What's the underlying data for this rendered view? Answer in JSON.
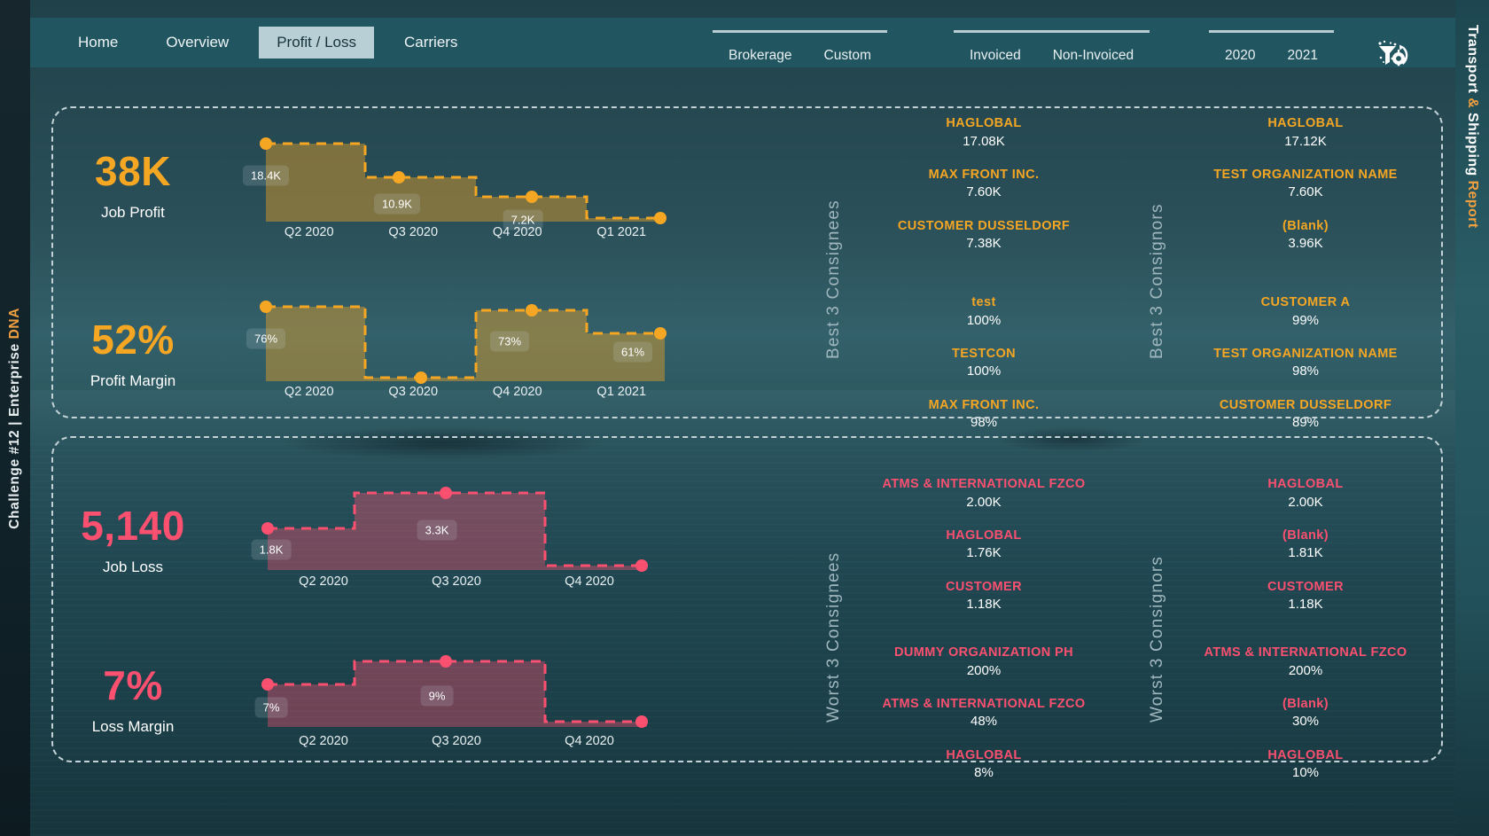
{
  "branding": {
    "left_rail_text": "Challenge #12 | Enterprise DNA",
    "left_rail_plain": "Challenge #12 | Enterprise ",
    "left_rail_accent": "DNA",
    "right_rail_part1": "Transport ",
    "right_rail_accent1": "&",
    "right_rail_part2": " Shipping ",
    "right_rail_accent2": "Report"
  },
  "nav": {
    "tabs": [
      {
        "label": "Home",
        "active": false
      },
      {
        "label": "Overview",
        "active": false
      },
      {
        "label": "Profit / Loss",
        "active": true
      },
      {
        "label": "Carriers",
        "active": false
      }
    ],
    "slicer_type": [
      "Brokerage",
      "Custom"
    ],
    "slicer_invoice": [
      "Invoiced",
      "Non-Invoiced"
    ],
    "slicer_year": [
      "2020",
      "2021"
    ],
    "reset_icon": "filter-reset-icon"
  },
  "kpis": {
    "job_profit": {
      "value": "38K",
      "label": "Job Profit"
    },
    "profit_margin": {
      "value": "52%",
      "label": "Profit Margin"
    },
    "job_loss": {
      "value": "5,140",
      "label": "Job Loss"
    },
    "loss_margin": {
      "value": "7%",
      "label": "Loss Margin"
    }
  },
  "chart_data": [
    {
      "id": "job-profit",
      "type": "area",
      "title": "Job Profit",
      "categories": [
        "Q2 2020",
        "Q3 2020",
        "Q4 2020",
        "Q1 2021"
      ],
      "values": [
        18400,
        10900,
        7200,
        0
      ],
      "labels": [
        "18.4K",
        "10.9K",
        "7.2K",
        ""
      ],
      "color": "#f5a623",
      "ylim": [
        0,
        18400
      ],
      "grid": false,
      "legend": "none"
    },
    {
      "id": "profit-margin",
      "type": "area",
      "title": "Profit Margin",
      "categories": [
        "Q2 2020",
        "Q3 2020",
        "Q4 2020",
        "Q1 2021"
      ],
      "values": [
        76,
        0,
        73,
        61
      ],
      "labels": [
        "76%",
        "",
        "73%",
        "61%"
      ],
      "color": "#f5a623",
      "ylim": [
        0,
        76
      ],
      "grid": false,
      "legend": "none"
    },
    {
      "id": "job-loss",
      "type": "area",
      "title": "Job Loss",
      "categories": [
        "Q2 2020",
        "Q3 2020",
        "Q4 2020"
      ],
      "values": [
        1800,
        3300,
        0
      ],
      "labels": [
        "1.8K",
        "3.3K",
        ""
      ],
      "color": "#fb4f6f",
      "ylim": [
        0,
        3300
      ],
      "grid": false,
      "legend": "none"
    },
    {
      "id": "loss-margin",
      "type": "area",
      "title": "Loss Margin",
      "categories": [
        "Q2 2020",
        "Q3 2020",
        "Q4 2020"
      ],
      "values": [
        7,
        9,
        0
      ],
      "labels": [
        "7%",
        "9%",
        ""
      ],
      "color": "#fb4f6f",
      "ylim": [
        0,
        9
      ],
      "grid": false,
      "legend": "none"
    }
  ],
  "rankings": {
    "best_consignees": {
      "title": "Best 3 Consignees",
      "profit": [
        {
          "name": "HAGLOBAL",
          "value": "17.08K"
        },
        {
          "name": "MAX FRONT INC.",
          "value": "7.60K"
        },
        {
          "name": "CUSTOMER DUSSELDORF",
          "value": "7.38K"
        }
      ],
      "margin": [
        {
          "name": "test",
          "value": "100%"
        },
        {
          "name": "TESTCON",
          "value": "100%"
        },
        {
          "name": "MAX FRONT INC.",
          "value": "98%"
        }
      ]
    },
    "best_consignors": {
      "title": "Best 3 Consignors",
      "profit": [
        {
          "name": "HAGLOBAL",
          "value": "17.12K"
        },
        {
          "name": "TEST ORGANIZATION NAME",
          "value": "7.60K"
        },
        {
          "name": "(Blank)",
          "value": "3.96K"
        }
      ],
      "margin": [
        {
          "name": "CUSTOMER A",
          "value": "99%"
        },
        {
          "name": "TEST ORGANIZATION NAME",
          "value": "98%"
        },
        {
          "name": "CUSTOMER DUSSELDORF",
          "value": "89%"
        }
      ]
    },
    "worst_consignees": {
      "title": "Worst 3 Consignees",
      "loss": [
        {
          "name": "ATMS & INTERNATIONAL FZCO",
          "value": "2.00K"
        },
        {
          "name": "HAGLOBAL",
          "value": "1.76K"
        },
        {
          "name": "CUSTOMER",
          "value": "1.18K"
        }
      ],
      "margin": [
        {
          "name": "DUMMY ORGANIZATION PH",
          "value": "200%"
        },
        {
          "name": "ATMS & INTERNATIONAL FZCO",
          "value": "48%"
        },
        {
          "name": "HAGLOBAL",
          "value": "8%"
        }
      ]
    },
    "worst_consignors": {
      "title": "Worst 3 Consignors",
      "loss": [
        {
          "name": "HAGLOBAL",
          "value": "2.00K"
        },
        {
          "name": "(Blank)",
          "value": "1.81K"
        },
        {
          "name": "CUSTOMER",
          "value": "1.18K"
        }
      ],
      "margin": [
        {
          "name": "ATMS & INTERNATIONAL FZCO",
          "value": "200%"
        },
        {
          "name": "(Blank)",
          "value": "30%"
        },
        {
          "name": "HAGLOBAL",
          "value": "10%"
        }
      ]
    }
  },
  "colors": {
    "gold": "#f5a623",
    "rose": "#fb4f6f",
    "panel_border": "#c3d2d7",
    "nav_bg": "#215560",
    "nav_active_bg": "#b9cfd6"
  }
}
